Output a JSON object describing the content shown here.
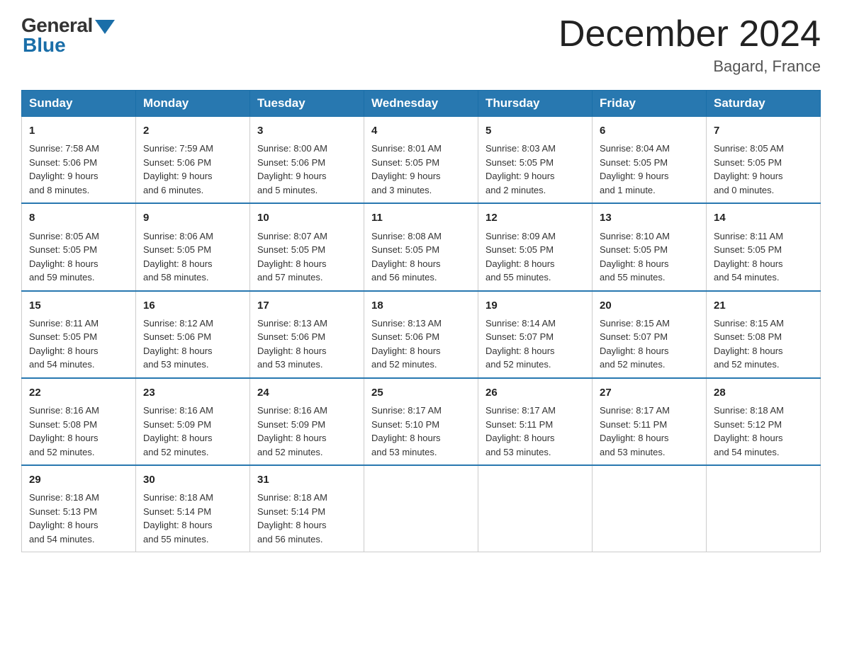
{
  "header": {
    "logo_general": "General",
    "logo_blue": "Blue",
    "title": "December 2024",
    "location": "Bagard, France"
  },
  "days_of_week": [
    "Sunday",
    "Monday",
    "Tuesday",
    "Wednesday",
    "Thursday",
    "Friday",
    "Saturday"
  ],
  "weeks": [
    [
      {
        "day": "1",
        "sunrise": "7:58 AM",
        "sunset": "5:06 PM",
        "daylight": "9 hours and 8 minutes."
      },
      {
        "day": "2",
        "sunrise": "7:59 AM",
        "sunset": "5:06 PM",
        "daylight": "9 hours and 6 minutes."
      },
      {
        "day": "3",
        "sunrise": "8:00 AM",
        "sunset": "5:06 PM",
        "daylight": "9 hours and 5 minutes."
      },
      {
        "day": "4",
        "sunrise": "8:01 AM",
        "sunset": "5:05 PM",
        "daylight": "9 hours and 3 minutes."
      },
      {
        "day": "5",
        "sunrise": "8:03 AM",
        "sunset": "5:05 PM",
        "daylight": "9 hours and 2 minutes."
      },
      {
        "day": "6",
        "sunrise": "8:04 AM",
        "sunset": "5:05 PM",
        "daylight": "9 hours and 1 minute."
      },
      {
        "day": "7",
        "sunrise": "8:05 AM",
        "sunset": "5:05 PM",
        "daylight": "9 hours and 0 minutes."
      }
    ],
    [
      {
        "day": "8",
        "sunrise": "8:05 AM",
        "sunset": "5:05 PM",
        "daylight": "8 hours and 59 minutes."
      },
      {
        "day": "9",
        "sunrise": "8:06 AM",
        "sunset": "5:05 PM",
        "daylight": "8 hours and 58 minutes."
      },
      {
        "day": "10",
        "sunrise": "8:07 AM",
        "sunset": "5:05 PM",
        "daylight": "8 hours and 57 minutes."
      },
      {
        "day": "11",
        "sunrise": "8:08 AM",
        "sunset": "5:05 PM",
        "daylight": "8 hours and 56 minutes."
      },
      {
        "day": "12",
        "sunrise": "8:09 AM",
        "sunset": "5:05 PM",
        "daylight": "8 hours and 55 minutes."
      },
      {
        "day": "13",
        "sunrise": "8:10 AM",
        "sunset": "5:05 PM",
        "daylight": "8 hours and 55 minutes."
      },
      {
        "day": "14",
        "sunrise": "8:11 AM",
        "sunset": "5:05 PM",
        "daylight": "8 hours and 54 minutes."
      }
    ],
    [
      {
        "day": "15",
        "sunrise": "8:11 AM",
        "sunset": "5:05 PM",
        "daylight": "8 hours and 54 minutes."
      },
      {
        "day": "16",
        "sunrise": "8:12 AM",
        "sunset": "5:06 PM",
        "daylight": "8 hours and 53 minutes."
      },
      {
        "day": "17",
        "sunrise": "8:13 AM",
        "sunset": "5:06 PM",
        "daylight": "8 hours and 53 minutes."
      },
      {
        "day": "18",
        "sunrise": "8:13 AM",
        "sunset": "5:06 PM",
        "daylight": "8 hours and 52 minutes."
      },
      {
        "day": "19",
        "sunrise": "8:14 AM",
        "sunset": "5:07 PM",
        "daylight": "8 hours and 52 minutes."
      },
      {
        "day": "20",
        "sunrise": "8:15 AM",
        "sunset": "5:07 PM",
        "daylight": "8 hours and 52 minutes."
      },
      {
        "day": "21",
        "sunrise": "8:15 AM",
        "sunset": "5:08 PM",
        "daylight": "8 hours and 52 minutes."
      }
    ],
    [
      {
        "day": "22",
        "sunrise": "8:16 AM",
        "sunset": "5:08 PM",
        "daylight": "8 hours and 52 minutes."
      },
      {
        "day": "23",
        "sunrise": "8:16 AM",
        "sunset": "5:09 PM",
        "daylight": "8 hours and 52 minutes."
      },
      {
        "day": "24",
        "sunrise": "8:16 AM",
        "sunset": "5:09 PM",
        "daylight": "8 hours and 52 minutes."
      },
      {
        "day": "25",
        "sunrise": "8:17 AM",
        "sunset": "5:10 PM",
        "daylight": "8 hours and 53 minutes."
      },
      {
        "day": "26",
        "sunrise": "8:17 AM",
        "sunset": "5:11 PM",
        "daylight": "8 hours and 53 minutes."
      },
      {
        "day": "27",
        "sunrise": "8:17 AM",
        "sunset": "5:11 PM",
        "daylight": "8 hours and 53 minutes."
      },
      {
        "day": "28",
        "sunrise": "8:18 AM",
        "sunset": "5:12 PM",
        "daylight": "8 hours and 54 minutes."
      }
    ],
    [
      {
        "day": "29",
        "sunrise": "8:18 AM",
        "sunset": "5:13 PM",
        "daylight": "8 hours and 54 minutes."
      },
      {
        "day": "30",
        "sunrise": "8:18 AM",
        "sunset": "5:14 PM",
        "daylight": "8 hours and 55 minutes."
      },
      {
        "day": "31",
        "sunrise": "8:18 AM",
        "sunset": "5:14 PM",
        "daylight": "8 hours and 56 minutes."
      },
      null,
      null,
      null,
      null
    ]
  ],
  "labels": {
    "sunrise": "Sunrise:",
    "sunset": "Sunset:",
    "daylight": "Daylight:"
  }
}
